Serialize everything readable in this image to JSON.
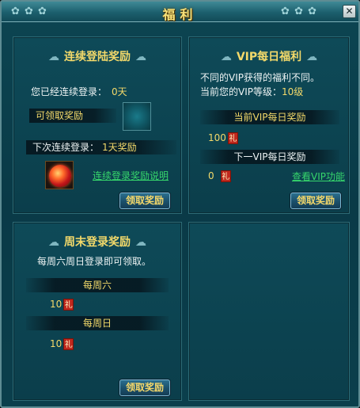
{
  "window": {
    "title": "福利",
    "ornament_left": "✿ ✿ ✿",
    "ornament_right": "✿ ✿ ✿",
    "close_label": "✕"
  },
  "consecutive": {
    "title": "连续登陆奖励",
    "login_label": "您已经连续登录：",
    "login_days": "0天",
    "claimable_label": "可领取奖励",
    "next_label": "下次连续登录：",
    "next_value": "1天奖励",
    "help_link": "连续登录奖励说明",
    "claim_button": "领取奖励"
  },
  "vip": {
    "title": "VIP每日福利",
    "desc_line1": "不同的VIP获得的福利不同。",
    "level_label": "当前您的VIP等级：",
    "level_value": "10级",
    "current_header": "当前VIP每日奖励",
    "current_amount": "100",
    "next_header": "下一VIP每日奖励",
    "next_amount": "0",
    "view_link": "查看VIP功能",
    "claim_button": "领取奖励"
  },
  "weekend": {
    "title": "周末登录奖励",
    "desc": "每周六周日登录即可领取。",
    "saturday_header": "每周六",
    "saturday_amount": "10",
    "sunday_header": "每周日",
    "sunday_amount": "10",
    "claim_button": "领取奖励"
  },
  "gift_badge": "礼",
  "cloud_icon": "~"
}
